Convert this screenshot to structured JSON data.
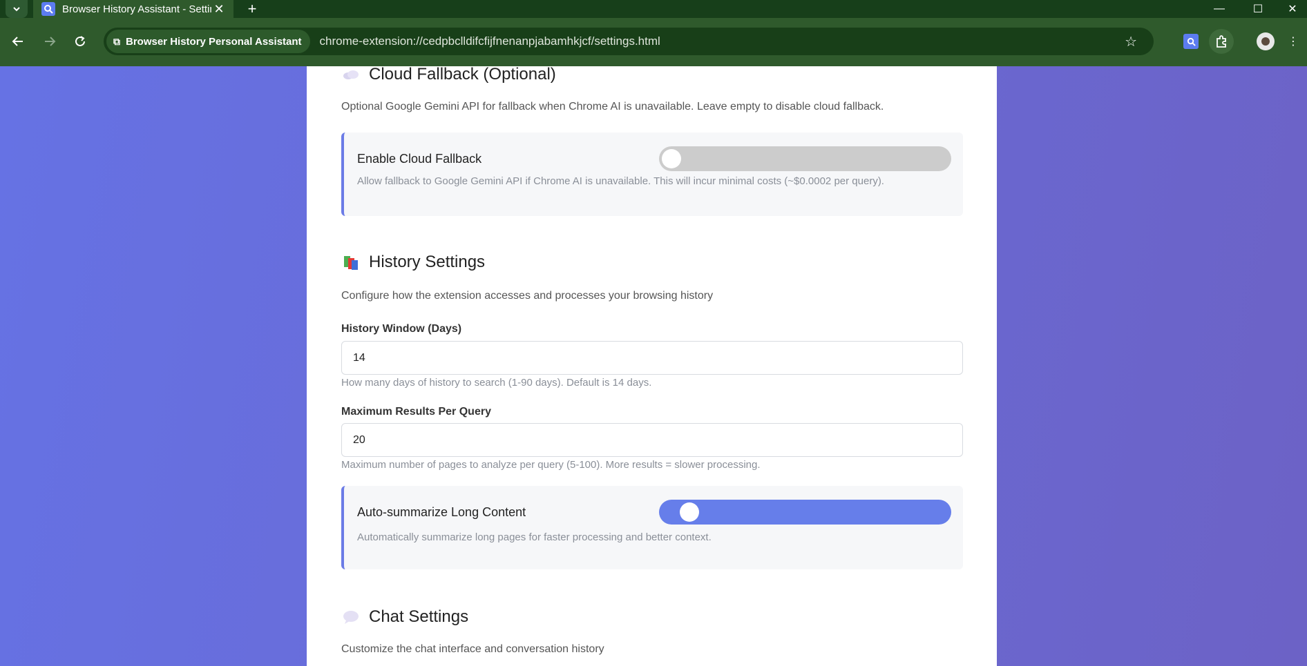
{
  "browser": {
    "tab_title": "Browser History Assistant - Settings",
    "chip_label": "Browser History Personal Assistant",
    "url": "chrome-extension://cedpbclldifcfijfnenanpjabamhkjcf/settings.html"
  },
  "cloud": {
    "heading": "Cloud Fallback (Optional)",
    "description": "Optional Google Gemini API for fallback when Chrome AI is unavailable. Leave empty to disable cloud fallback.",
    "toggle_label": "Enable Cloud Fallback",
    "toggle_hint": "Allow fallback to Google Gemini API if Chrome AI is unavailable. This will incur minimal costs (~$0.0002 per query).",
    "toggle_on": false
  },
  "history": {
    "heading": "History Settings",
    "description": "Configure how the extension accesses and processes your browsing history",
    "window_label": "History Window (Days)",
    "window_value": "14",
    "window_hint": "How many days of history to search (1-90 days). Default is 14 days.",
    "max_label": "Maximum Results Per Query",
    "max_value": "20",
    "max_hint": "Maximum number of pages to analyze per query (5-100). More results = slower processing.",
    "auto_label": "Auto-summarize Long Content",
    "auto_hint": "Automatically summarize long pages for faster processing and better context.",
    "auto_on": true
  },
  "chat": {
    "heading": "Chat Settings",
    "description": "Customize the chat interface and conversation history"
  },
  "colors": {
    "accent": "#667eea",
    "switch_off": "#cccccc",
    "chrome_green": "#2f5a2c"
  }
}
